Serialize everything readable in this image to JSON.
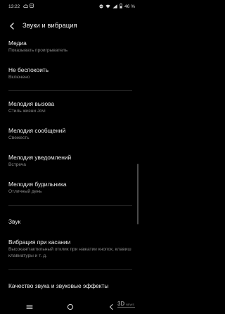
{
  "status_bar": {
    "time": "13:22",
    "battery": "46 %"
  },
  "header": {
    "title": "Звуки и вибрация",
    "back_icon": "arrow-left-icon"
  },
  "items": [
    {
      "title": "Медиа",
      "subtitle": "Показывать проигрыватель"
    },
    {
      "title": "Не беспокоить",
      "subtitle": "Включено"
    },
    {
      "title": "Мелодия вызова",
      "subtitle": "Стиль жизни Jovi"
    },
    {
      "title": "Мелодия сообщений",
      "subtitle": "Свежесть"
    },
    {
      "title": "Мелодия уведомлений",
      "subtitle": "Встреча"
    },
    {
      "title": "Мелодия будильника",
      "subtitle": "Отличный день"
    },
    {
      "title": "Звук",
      "subtitle": ""
    },
    {
      "title": "Вибрация при касании",
      "subtitle": "Высокая/тактильный отклик при нажатии кнопок, клавиш клавиатуры и т. д."
    },
    {
      "title": "Качество звука и звуковые эффекты",
      "subtitle": ""
    }
  ],
  "nav_bar": {
    "icons": [
      "menu-icon",
      "home-icon",
      "back-icon"
    ]
  },
  "watermark": {
    "text": "3D NEWS"
  },
  "colors": {
    "background": "#000000",
    "text_primary": "#f0f0f0",
    "text_secondary": "#8a8a8a",
    "divider": "#262626"
  }
}
